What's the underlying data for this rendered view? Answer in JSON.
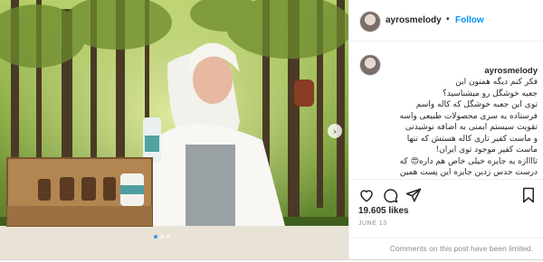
{
  "header": {
    "username": "ayrosmelody",
    "separator": "•",
    "follow_label": "Follow"
  },
  "caption": {
    "username": "ayrosmelody",
    "text": "فکر کنم دیگه همتون این\nجعبه خوشگل رو میشناسید؟\nتوی این جعبه خوشگل که کاله واسم\nفرستاده یه سری محصولات طبیعی واسه\nتقویت سیستم ایمنی به اضافه نوشیدنی\nو ماست کفیر تاری کاله هستش که تنها\nماست کفیر موجود توی ایران!\nتاااازه یه جایزه خیلی خاص هم داره😍 که\nدرست حدس زدین جایزه این پست همین\nجعبه خوشگل و محتویاتش هستش😍\nمطمئنا کفیر تاری رو خیلیاتون میشناسید به\nجز..."
  },
  "stats": {
    "likes": "19.605 likes",
    "date": "JUNE 13"
  },
  "footer": {
    "comments_limited": "Comments on this post have been limited."
  },
  "colors": {
    "accent": "#0095f6",
    "muted": "#8e8e8e"
  },
  "icons": {
    "like": "heart-icon",
    "comment": "comment-icon",
    "share": "share-icon",
    "save": "bookmark-icon",
    "next": "chevron-right-icon"
  }
}
